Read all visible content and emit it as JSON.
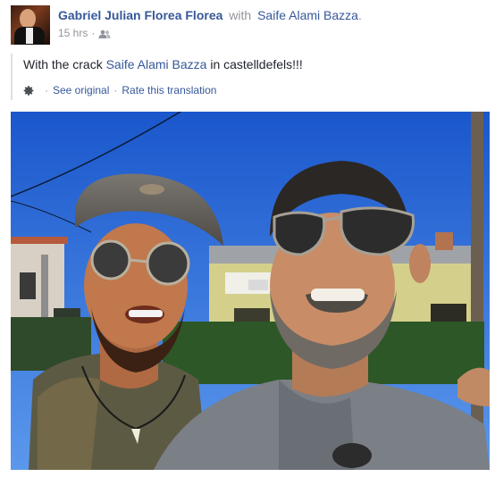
{
  "post": {
    "author": "Gabriel Julian Florea Florea",
    "with_text": "with",
    "tagged": "Saife Alami Bazza",
    "period": ".",
    "time": "15 hrs",
    "dot": "·",
    "audience_icon": "friends-icon",
    "text_before": "With the crack ",
    "text_mention": "Saife Alami Bazza",
    "text_after": " in castelldefels!!!",
    "translation": {
      "settings_icon": "gear-icon",
      "see_original": "See original",
      "separator": "·",
      "rate": "Rate this translation"
    }
  },
  "colors": {
    "link": "#365899",
    "secondary": "#90949c",
    "body_text": "#1d2129"
  }
}
